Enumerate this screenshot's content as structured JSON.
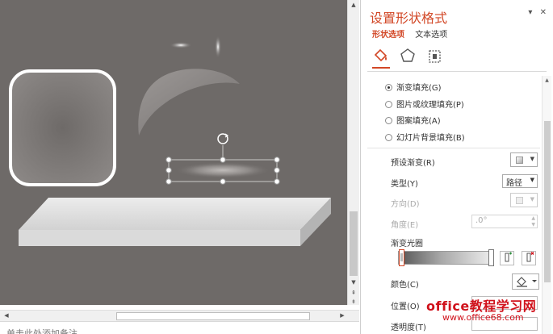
{
  "canvas": {
    "notes_placeholder": "单击此处添加备注"
  },
  "panel": {
    "title": "设置形状格式",
    "controls": [
      "▾",
      "✕"
    ],
    "tabs": [
      {
        "label": "形状选项",
        "active": true
      },
      {
        "label": "文本选项",
        "active": false
      }
    ],
    "category_icons": [
      "fill-line-icon",
      "effects-icon",
      "size-properties-icon"
    ],
    "fill_options": [
      {
        "label": "渐变填充(G)",
        "selected": true
      },
      {
        "label": "图片或纹理填充(P)",
        "selected": false
      },
      {
        "label": "图案填充(A)",
        "selected": false
      },
      {
        "label": "幻灯片背景填充(B)",
        "selected": false
      }
    ],
    "preset_gradient_label": "预设渐变(R)",
    "type_label": "类型(Y)",
    "type_value": "路径",
    "direction_label": "方向(D)",
    "angle_label": "角度(E)",
    "angle_value": ".0°",
    "gradient_stops_label": "渐变光圈",
    "add_stop_icon": "add-gradient-stop-icon",
    "remove_stop_icon": "remove-gradient-stop-icon",
    "color_label": "颜色(C)",
    "position_label": "位置(O)",
    "transparency_label": "透明度(T)"
  },
  "watermark": {
    "brand": "office教程学习网",
    "url": "www.office68.com"
  },
  "colors": {
    "accent": "#d24726",
    "canvas_bg": "#6e6a68",
    "watermark": "#d0121c"
  }
}
